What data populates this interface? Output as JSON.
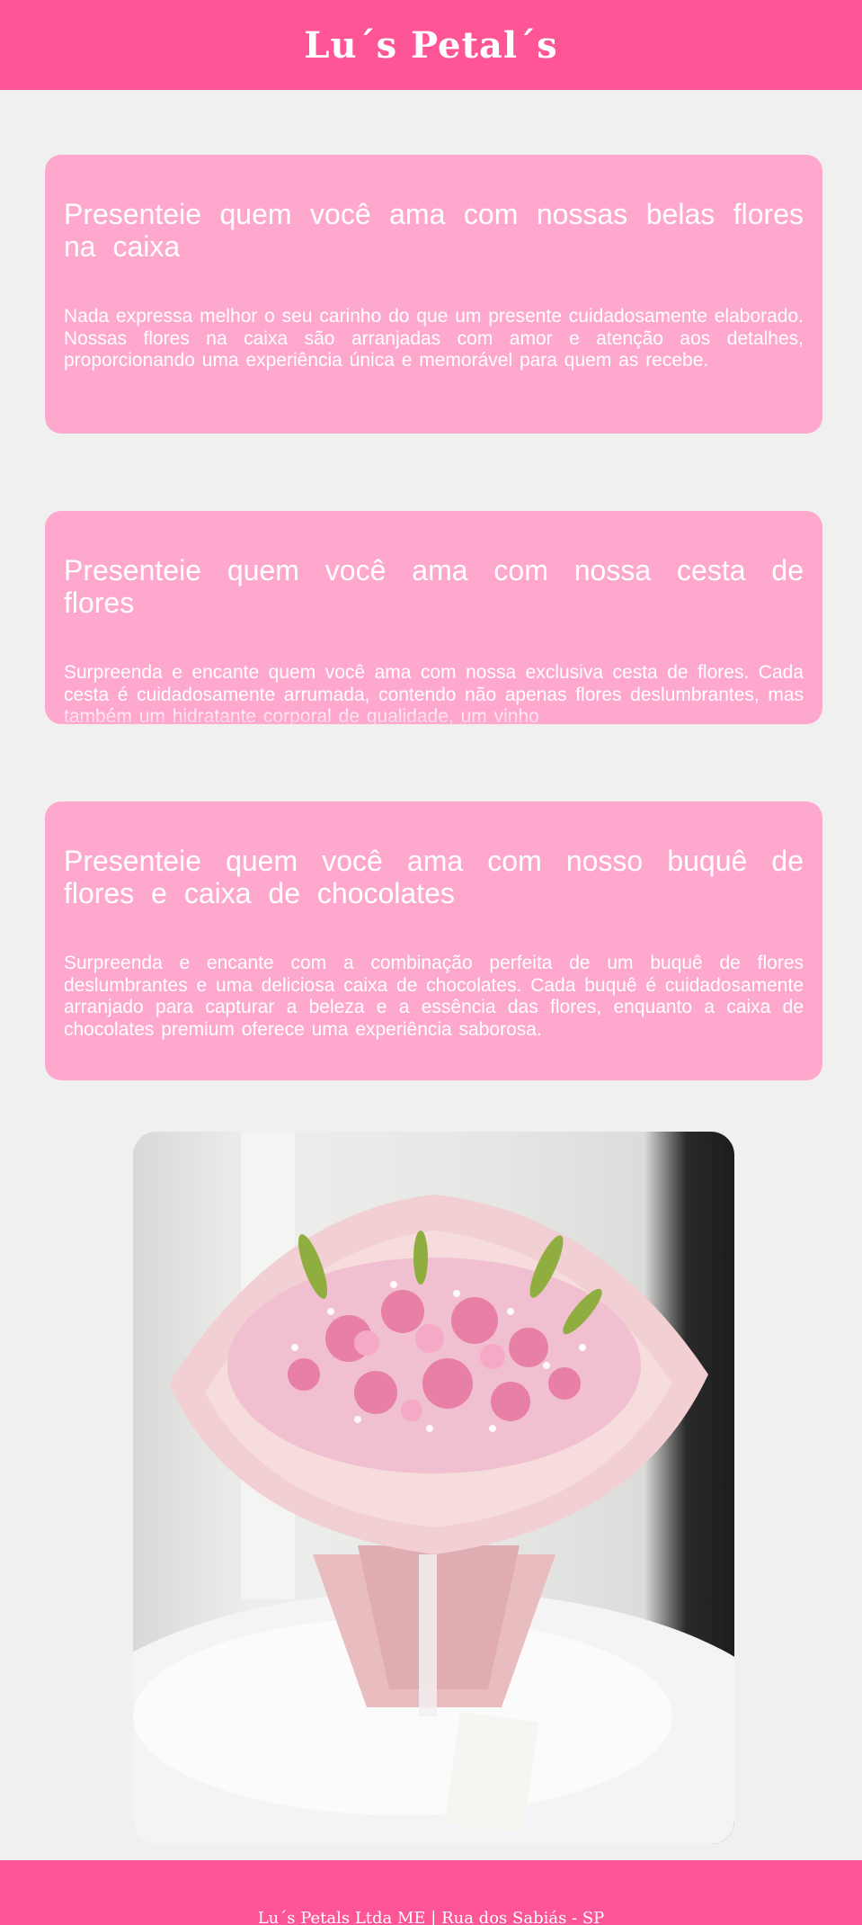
{
  "header": {
    "title": "Lu´s Petal´s"
  },
  "cards": [
    {
      "title": "Presenteie quem você ama com nossas belas flores na caixa",
      "text": "Nada expressa melhor o seu carinho do que um presente cuidadosamente elaborado. Nossas flores na caixa são arranjadas com amor e atenção aos detalhes, proporcionando uma experiência única e memorável para quem as recebe."
    },
    {
      "title": "Presenteie quem você ama com nossa cesta de flores",
      "text": "Surpreenda e encante quem você ama com nossa exclusiva cesta de flores. Cada cesta é cuidadosamente arrumada, contendo não apenas flores deslumbrantes, mas também um hidratante corporal de qualidade, um vinho"
    },
    {
      "title": "Presenteie quem você ama com nosso buquê de flores e caixa de chocolates",
      "text": "Surpreenda e encante com a combinação perfeita de um buquê de flores deslumbrantes e uma deliciosa caixa de chocolates. Cada buquê é cuidadosamente arranjado para capturar a beleza e a essência das flores, enquanto a caixa de chocolates premium oferece uma experiência saborosa."
    }
  ],
  "footer": {
    "text": "Lu´s Petals Ltda ME | Rua dos Sabiás - SP"
  },
  "colors": {
    "brand": "#fd5595",
    "card": "#ffa8cd",
    "background": "#f0f0f0",
    "text_on_brand": "#ffffff"
  }
}
